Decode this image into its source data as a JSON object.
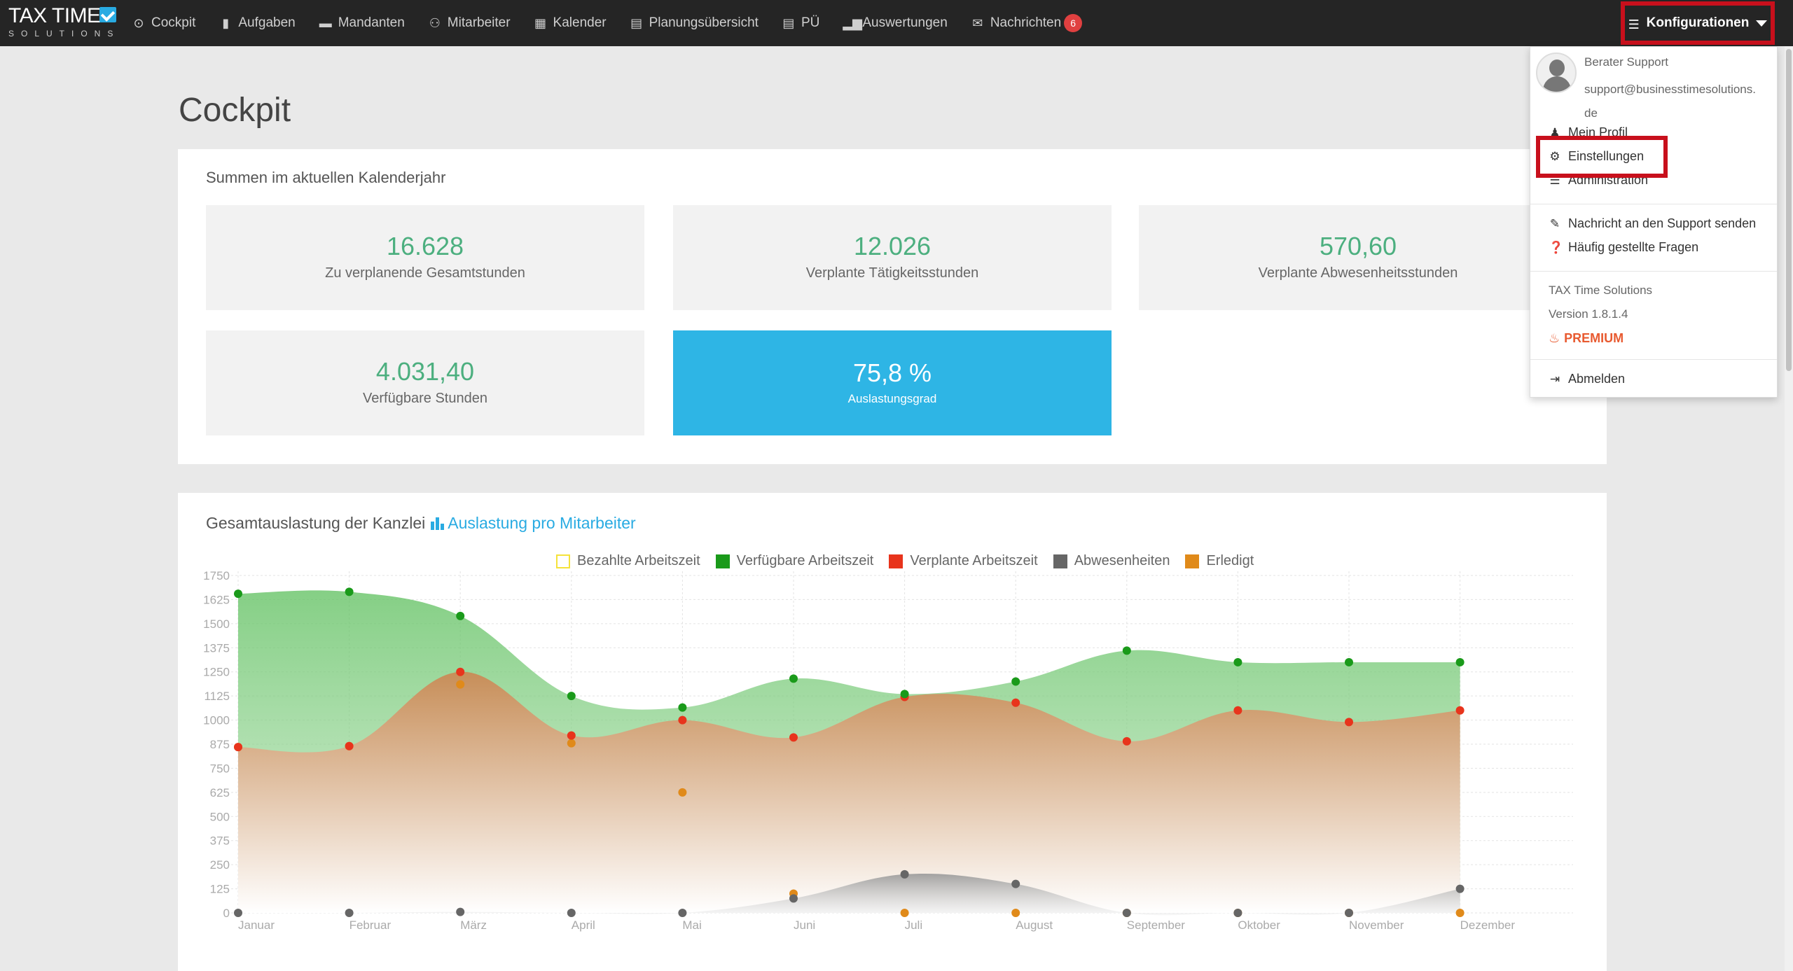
{
  "brand": {
    "line1": "TAX TIME",
    "line2": "SOLUTIONS"
  },
  "nav": {
    "items": [
      {
        "label": "Cockpit",
        "icon": "clock-icon"
      },
      {
        "label": "Aufgaben",
        "icon": "bookmark-icon"
      },
      {
        "label": "Mandanten",
        "icon": "folder-icon"
      },
      {
        "label": "Mitarbeiter",
        "icon": "users-icon"
      },
      {
        "label": "Kalender",
        "icon": "calendar-icon"
      },
      {
        "label": "Planungsübersicht",
        "icon": "list-icon"
      },
      {
        "label": "PÜ",
        "icon": "list-icon"
      },
      {
        "label": "Auswertungen",
        "icon": "bar-chart-icon"
      },
      {
        "label": "Nachrichten",
        "icon": "envelope-icon",
        "badge": "6"
      }
    ],
    "config_label": "Konfigurationen"
  },
  "page": {
    "title": "Cockpit"
  },
  "summary": {
    "heading": "Summen im aktuellen Kalenderjahr",
    "kpis": [
      {
        "value": "16.628",
        "label": "Zu verplanende Gesamtstunden"
      },
      {
        "value": "12.026",
        "label": "Verplante Tätigkeitsstunden"
      },
      {
        "value": "570,60",
        "label": "Verplante Abwesenheitsstunden"
      },
      {
        "value": "4.031,40",
        "label": "Verfügbare Stunden"
      },
      {
        "value": "75,8 %",
        "label": "Auslastungsgrad"
      }
    ]
  },
  "chart_panel": {
    "heading": "Gesamtauslastung der Kanzlei",
    "link": "Auslastung pro Mitarbeiter"
  },
  "dropdown": {
    "user_name": "Berater Support",
    "user_email": "support@businesstimesolutions.de",
    "items": {
      "profile": "Mein Profil",
      "settings": "Einstellungen",
      "admin": "Administration",
      "support": "Nachricht an den Support senden",
      "faq": "Häufig gestellte Fragen",
      "logout": "Abmelden"
    },
    "product": "TAX Time Solutions",
    "version": "Version 1.8.1.4",
    "edition": "PREMIUM"
  },
  "colors": {
    "accent": "#29abe2",
    "kpi_value": "#4caf7f",
    "highlight": "#c8101c",
    "green": "#1a9a1a",
    "red": "#e8341c",
    "gray": "#666666",
    "orange": "#e08a1a",
    "yellow": "#f5e23a"
  },
  "chart_data": {
    "type": "area",
    "categories": [
      "Januar",
      "Februar",
      "März",
      "April",
      "Mai",
      "Juni",
      "Juli",
      "August",
      "September",
      "Oktober",
      "November",
      "Dezember"
    ],
    "yticks": [
      0,
      125,
      250,
      375,
      500,
      625,
      750,
      875,
      1000,
      1125,
      1250,
      1375,
      1500,
      1625,
      1750
    ],
    "ylim": [
      0,
      1750
    ],
    "grid": true,
    "legend_position": "top",
    "series": [
      {
        "name": "Bezahlte Arbeitszeit",
        "color": "#f5e23a",
        "values": []
      },
      {
        "name": "Verfügbare Arbeitszeit",
        "color": "#1a9a1a",
        "values": [
          1655,
          1665,
          1540,
          1125,
          1065,
          1215,
          1135,
          1200,
          1360,
          1300,
          1300,
          1300
        ]
      },
      {
        "name": "Verplante Arbeitszeit",
        "color": "#e8341c",
        "values": [
          860,
          865,
          1250,
          920,
          1000,
          910,
          1120,
          1090,
          890,
          1050,
          990,
          1050
        ]
      },
      {
        "name": "Abwesenheiten",
        "color": "#666666",
        "values": [
          0,
          0,
          5,
          0,
          0,
          75,
          200,
          150,
          0,
          0,
          0,
          125
        ]
      },
      {
        "name": "Erledigt",
        "color": "#e08a1a",
        "values": [
          860,
          865,
          1185,
          880,
          625,
          100,
          0,
          0,
          0,
          0,
          0,
          0
        ]
      }
    ]
  }
}
